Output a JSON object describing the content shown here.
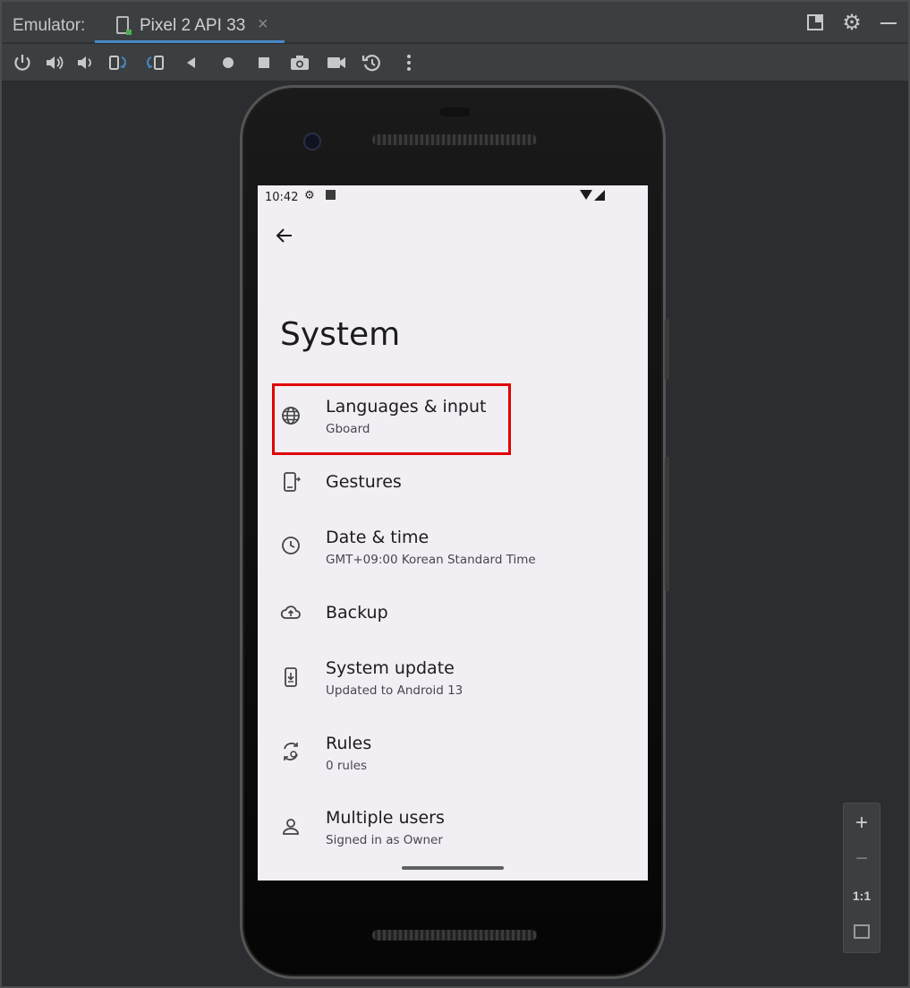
{
  "window": {
    "emulator_label": "Emulator:",
    "device_tab": "Pixel 2 API 33",
    "close_glyph": "×"
  },
  "toolbar": {
    "icons": [
      "power-icon",
      "volume-up-icon",
      "volume-down-icon",
      "rotate-left-icon",
      "rotate-right-icon",
      "back-icon",
      "home-icon",
      "overview-icon",
      "screenshot-icon",
      "screen-record-icon",
      "snapshot-icon",
      "more-icon"
    ]
  },
  "phone": {
    "status_time": "10:42",
    "page_title": "System",
    "items": [
      {
        "title": "Languages & input",
        "subtitle": "Gboard",
        "icon": "globe-icon"
      },
      {
        "title": "Gestures",
        "subtitle": "",
        "icon": "gestures-icon"
      },
      {
        "title": "Date & time",
        "subtitle": "GMT+09:00 Korean Standard Time",
        "icon": "clock-icon"
      },
      {
        "title": "Backup",
        "subtitle": "",
        "icon": "cloud-upload-icon"
      },
      {
        "title": "System update",
        "subtitle": "Updated to Android 13",
        "icon": "system-update-icon"
      },
      {
        "title": "Rules",
        "subtitle": "0 rules",
        "icon": "rules-icon"
      },
      {
        "title": "Multiple users",
        "subtitle": "Signed in as Owner",
        "icon": "person-icon"
      }
    ]
  },
  "zoom": {
    "plus": "+",
    "minus": "−",
    "one_to_one": "1:1"
  },
  "colors": {
    "highlight": "#e00000",
    "tab_underline": "#4a88c7",
    "screen_bg": "#f2eff4"
  }
}
